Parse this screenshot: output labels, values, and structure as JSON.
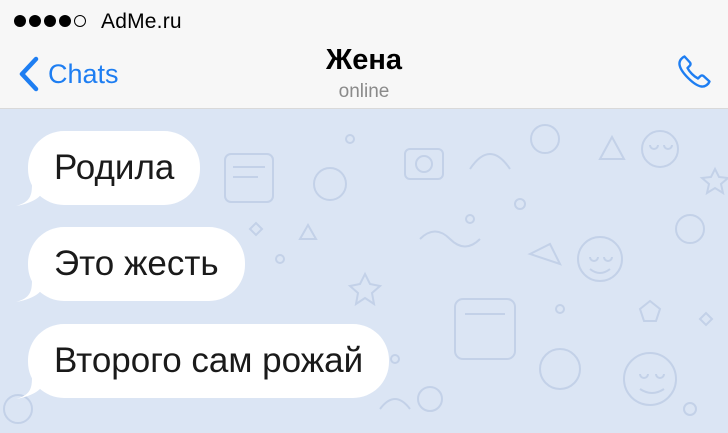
{
  "status_bar": {
    "carrier": "AdMe.ru",
    "signal_filled": 4,
    "signal_total": 5
  },
  "nav": {
    "back_label": "Chats",
    "contact_name": "Жена",
    "contact_status": "online",
    "icons": {
      "back": "chevron-left-icon",
      "call": "phone-icon"
    }
  },
  "colors": {
    "accent": "#1e7ef2",
    "chat_background": "#dbe5f4",
    "bubble": "#ffffff",
    "status_text": "#8a8a8a"
  },
  "messages": [
    {
      "direction": "incoming",
      "text": "Родила"
    },
    {
      "direction": "incoming",
      "text": "Это жесть"
    },
    {
      "direction": "incoming",
      "text": "Второго сам рожай"
    }
  ]
}
